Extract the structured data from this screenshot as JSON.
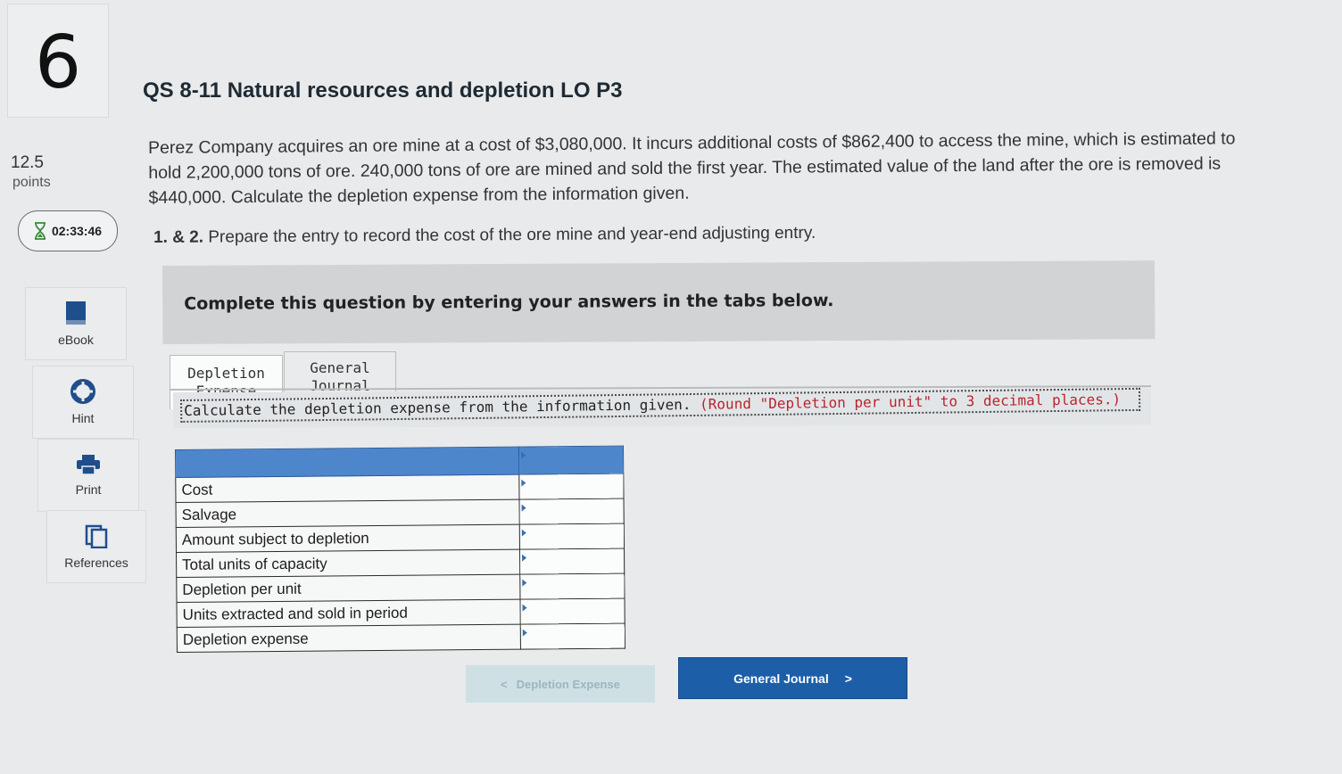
{
  "question": {
    "number": "6",
    "points_value": "12.5",
    "points_label": "points",
    "timer": "02:33:46",
    "title": "QS 8-11 Natural resources and depletion LO P3",
    "prompt": "Perez Company acquires an ore mine at a cost of $3,080,000. It incurs additional costs of $862,400 to access the mine, which is estimated to hold 2,200,000 tons of ore. 240,000 tons of ore are mined and sold the first year. The estimated value of the land after the ore is removed is $440,000. Calculate the depletion expense from the information given.",
    "sub_number": "1. & 2.",
    "sub_text": "Prepare the entry to record the cost of the ore mine and year-end adjusting entry."
  },
  "sidebar": {
    "tools": [
      {
        "label": "eBook",
        "icon": "book-icon"
      },
      {
        "label": "Hint",
        "icon": "lifebuoy-icon"
      },
      {
        "label": "Print",
        "icon": "printer-icon"
      },
      {
        "label": "References",
        "icon": "documents-icon"
      }
    ]
  },
  "banner": "Complete this question by entering your answers in the tabs below.",
  "tabs": [
    {
      "line1": "Depletion",
      "line2": "Expense",
      "active": true
    },
    {
      "line1": "General",
      "line2": "Journal",
      "active": false
    }
  ],
  "instruction": {
    "main": "Calculate the depletion expense from the information given.",
    "note": "(Round \"Depletion per unit\" to 3 decimal places.)"
  },
  "depletion_table": {
    "rows": [
      "Cost",
      "Salvage",
      "Amount subject to depletion",
      "Total units of capacity",
      "Depletion per unit",
      "Units extracted and sold in period",
      "Depletion expense"
    ]
  },
  "nav": {
    "prev_label": "Depletion Expense",
    "next_label": "General Journal"
  },
  "colors": {
    "header_blue": "#4e86cc",
    "button_blue": "#1d5ea8",
    "note_red": "#b8242c"
  }
}
